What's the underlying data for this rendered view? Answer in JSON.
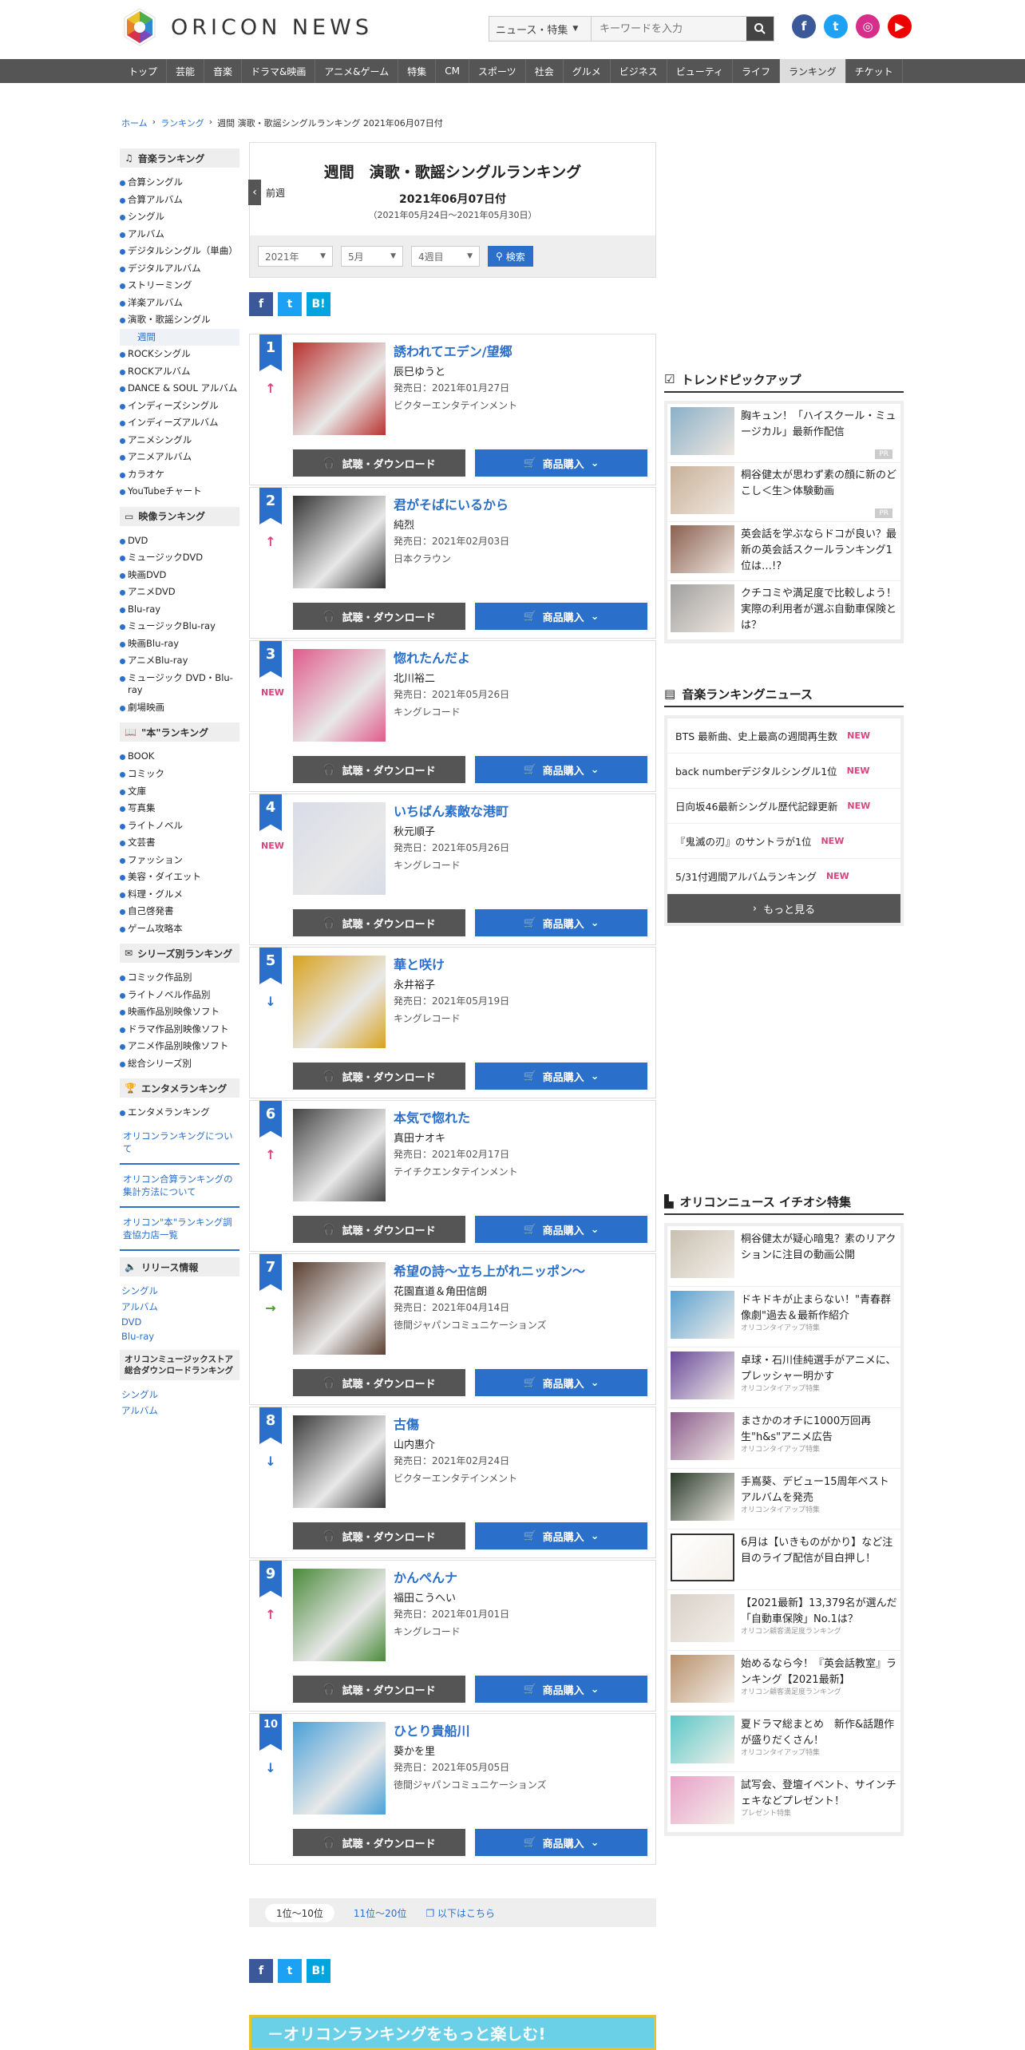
{
  "header": {
    "logo_text": "ORICON NEWS",
    "search_category": "ニュース・特集",
    "search_placeholder": "キーワードを入力"
  },
  "nav": [
    "トップ",
    "芸能",
    "音楽",
    "ドラマ&映画",
    "アニメ&ゲーム",
    "特集",
    "CM",
    "スポーツ",
    "社会",
    "グルメ",
    "ビジネス",
    "ビューティ",
    "ライフ",
    "ランキング",
    "チケット"
  ],
  "nav_active": 13,
  "breadcrumb": {
    "home": "ホーム",
    "ranking": "ランキング",
    "current": "週間 演歌・歌謡シングルランキング 2021年06月07日付"
  },
  "left": {
    "music_head": "音楽ランキング",
    "music": [
      "合算シングル",
      "合算アルバム",
      "シングル",
      "アルバム",
      "デジタルシングル（単曲）",
      "デジタルアルバム",
      "ストリーミング",
      "洋楽アルバム",
      "演歌・歌謡シングル"
    ],
    "music_sub": "週間",
    "music2": [
      "ROCKシングル",
      "ROCKアルバム",
      "DANCE & SOUL アルバム",
      "インディーズシングル",
      "インディーズアルバム",
      "アニメシングル",
      "アニメアルバム",
      "カラオケ",
      "YouTubeチャート"
    ],
    "video_head": "映像ランキング",
    "video": [
      "DVD",
      "ミュージックDVD",
      "映画DVD",
      "アニメDVD",
      "Blu-ray",
      "ミュージックBlu-ray",
      "映画Blu-ray",
      "アニメBlu-ray",
      "ミュージック DVD・Blu-ray",
      "劇場映画"
    ],
    "book_head": "\"本\"ランキング",
    "book": [
      "BOOK",
      "コミック",
      "文庫",
      "写真集",
      "ライトノベル",
      "文芸書",
      "ファッション",
      "美容・ダイエット",
      "料理・グルメ",
      "自己啓発書",
      "ゲーム攻略本"
    ],
    "series_head": "シリーズ別ランキング",
    "series": [
      "コミック作品別",
      "ライトノベル作品別",
      "映画作品別映像ソフト",
      "ドラマ作品別映像ソフト",
      "アニメ作品別映像ソフト",
      "総合シリーズ別"
    ],
    "ent_head": "エンタメランキング",
    "ent": [
      "エンタメランキング"
    ],
    "notes": [
      "オリコンランキングについて",
      "オリコン合算ランキングの集計方法について",
      "オリコン\"本\"ランキング調査協力店一覧"
    ],
    "release_head": "リリース情報",
    "release": [
      "シングル",
      "アルバム",
      "DVD",
      "Blu-ray"
    ],
    "store_head": "オリコンミュージックストア総合ダウンロードランキング",
    "store": [
      "シングル",
      "アルバム"
    ]
  },
  "main": {
    "title": "週間　演歌・歌謡シングルランキング",
    "prev": "前週",
    "date": "2021年06月07日付",
    "range": "（2021年05月24日～2021年05月30日）",
    "year": "2021年",
    "month": "5月",
    "week": "4週目",
    "search_btn": "検索",
    "try_label": "試聴・ダウンロード",
    "buy_label": "商品購入",
    "release_prefix": "発売日：",
    "ranks": [
      {
        "no": "1",
        "move": "up",
        "song": "誘われてエデン/望郷",
        "artist": "辰巳ゆうと",
        "date": "2021年01月27日",
        "label": "ビクターエンタテインメント",
        "color": "#b8322e"
      },
      {
        "no": "2",
        "move": "up",
        "song": "君がそばにいるから",
        "artist": "純烈",
        "date": "2021年02月03日",
        "label": "日本クラウン",
        "color": "#333"
      },
      {
        "no": "3",
        "move": "new",
        "song": "惚れたんだよ",
        "artist": "北川裕二",
        "date": "2021年05月26日",
        "label": "キングレコード",
        "color": "#e05a8a"
      },
      {
        "no": "4",
        "move": "new",
        "song": "いちばん素敵な港町",
        "artist": "秋元順子",
        "date": "2021年05月26日",
        "label": "キングレコード",
        "color": "#d8dce8"
      },
      {
        "no": "5",
        "move": "down",
        "song": "華と咲け",
        "artist": "永井裕子",
        "date": "2021年05月19日",
        "label": "キングレコード",
        "color": "#d8a21e"
      },
      {
        "no": "6",
        "move": "up",
        "song": "本気で惚れた",
        "artist": "真田ナオキ",
        "date": "2021年02月17日",
        "label": "テイチクエンタテインメント",
        "color": "#444"
      },
      {
        "no": "7",
        "move": "stay",
        "song": "希望の詩～立ち上がれニッポン～",
        "artist": "花園直道＆角田信朗",
        "date": "2021年04月14日",
        "label": "徳間ジャパンコミュニケーションズ",
        "color": "#5a4030"
      },
      {
        "no": "8",
        "move": "down",
        "song": "古傷",
        "artist": "山内惠介",
        "date": "2021年02月24日",
        "label": "ビクターエンタテインメント",
        "color": "#3a3a3a"
      },
      {
        "no": "9",
        "move": "up",
        "song": "かんぺんナ",
        "artist": "福田こうへい",
        "date": "2021年01月01日",
        "label": "キングレコード",
        "color": "#4a8a3a"
      },
      {
        "no": "10",
        "move": "down",
        "song": "ひとり貴船川",
        "artist": "葵かを里",
        "date": "2021年05月05日",
        "label": "徳間ジャパンコミュニケーションズ",
        "color": "#4aa0d8"
      }
    ],
    "pager": [
      "1位～10位",
      "11位～20位",
      "以下はこちら"
    ],
    "banner": "－オリコンランキングをもっと楽しむ!"
  },
  "right": {
    "trend_head": "トレンドピックアップ",
    "trend": [
      {
        "text": "胸キュン！「ハイスクール・ミュージカル」最新作配信",
        "pr": "PR",
        "color": "#8ab0c8"
      },
      {
        "text": "桐谷健太が思わず素の顔に新のどこし＜生＞体験動画",
        "pr": "PR",
        "color": "#c8b098"
      },
      {
        "text": "英会話を学ぶならドコが良い？最新の英会話スクールランキング1位は…!?",
        "pr": "",
        "color": "#8a6050"
      },
      {
        "text": "クチコミや満足度で比較しよう！実際の利用者が選ぶ自動車保険とは？",
        "pr": "",
        "color": "#a0a0a0"
      }
    ],
    "news_head": "音楽ランキングニュース",
    "news": [
      "BTS 最新曲、史上最高の週間再生数",
      "back numberデジタルシングル1位",
      "日向坂46最新シングル歴代記録更新",
      "『鬼滅の刃』のサントラが1位",
      "5/31付週間アルバムランキング"
    ],
    "new_label": "NEW",
    "more": "もっと見る",
    "pick_head": "オリコンニュース イチオシ特集",
    "pick": [
      {
        "text": "桐谷健太が疑心暗鬼？素のリアクションに注目の動画公開",
        "sub": "",
        "color": "#c8c0b0"
      },
      {
        "text": "ドキドキが止まらない！\"青春群像劇\"過去＆最新作紹介",
        "sub": "オリコンタイアップ特集",
        "color": "#5aa0d0"
      },
      {
        "text": "卓球・石川佳純選手がアニメに、プレッシャー明かす",
        "sub": "オリコンタイアップ特集",
        "color": "#6a4a9a"
      },
      {
        "text": "まさかのオチに1000万回再生\"h&s\"アニメ広告",
        "sub": "オリコンタイアップ特集",
        "color": "#8a5a8a"
      },
      {
        "text": "手嶌葵、デビュー15周年ベストアルバムを発売",
        "sub": "オリコンタイアップ特集",
        "color": "#2a3a2a"
      },
      {
        "text": "6月は【いきものがかり】など注目のライブ配信が目白押し！",
        "sub": "",
        "color": "#fff"
      },
      {
        "text": "【2021最新】13,379名が選んだ「自動車保険」No.1は？",
        "sub": "オリコン顧客満足度ランキング",
        "color": "#d8d0c8"
      },
      {
        "text": "始めるなら今！『英会話教室』ランキング【2021最新】",
        "sub": "オリコン顧客満足度ランキング",
        "color": "#b8906a"
      },
      {
        "text": "夏ドラマ総まとめ　新作&話題作が盛りだくさん！",
        "sub": "オリコンタイアップ特集",
        "color": "#5ac8c8"
      },
      {
        "text": "試写会、登壇イベント、サインチェキなどプレゼント！",
        "sub": "プレゼント特集",
        "color": "#e8a0c8"
      }
    ]
  }
}
